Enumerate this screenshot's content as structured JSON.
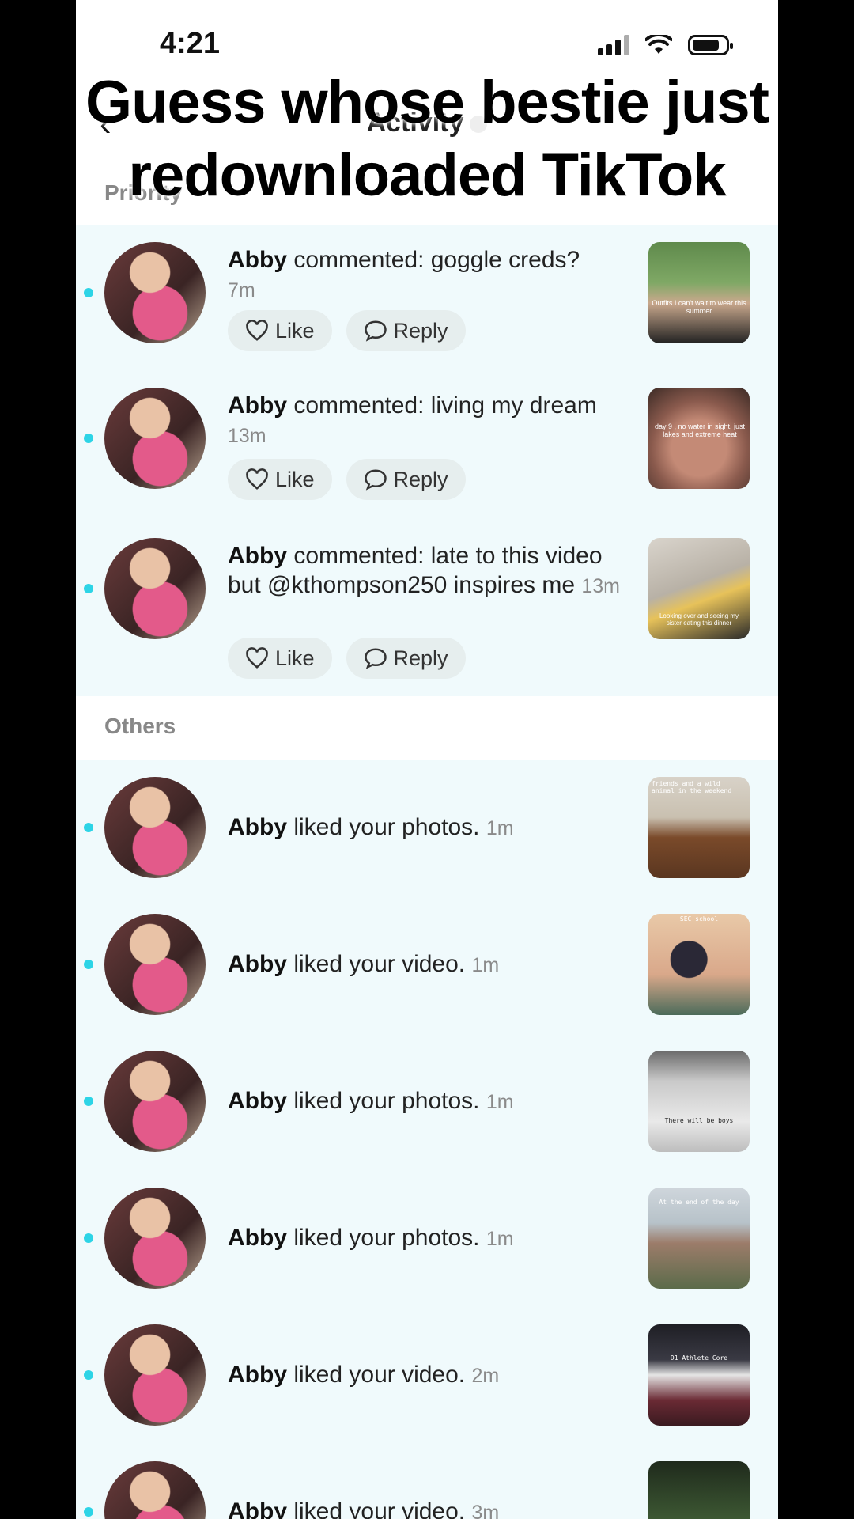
{
  "status_bar": {
    "time": "4:21"
  },
  "header": {
    "title": "Activity"
  },
  "overlay_caption": {
    "line1": "Guess whose bestie just",
    "line2": "redownloaded TikTok"
  },
  "sections": {
    "priority_label": "Priority",
    "others_label": "Others"
  },
  "actions": {
    "like": "Like",
    "reply": "Reply"
  },
  "priority_items": [
    {
      "user": "Abby",
      "text": "commented: goggle creds?",
      "time": "7m",
      "thumb_caption": "Outfits I can't wait to wear this summer"
    },
    {
      "user": "Abby",
      "text": "commented: living my dream",
      "time": "13m",
      "thumb_caption": "day 9 , no water in sight, just lakes and extreme heat"
    },
    {
      "user": "Abby",
      "text": "commented: late to this video but @kthompson250 inspires me",
      "time": "13m",
      "thumb_caption": "Looking over and seeing my sister eating this dinner"
    }
  ],
  "other_items": [
    {
      "user": "Abby",
      "text": "liked your photos.",
      "time": "1m",
      "thumb_caption": "friends and a wild animal in the weekend"
    },
    {
      "user": "Abby",
      "text": "liked your video.",
      "time": "1m",
      "thumb_caption": "SEC school"
    },
    {
      "user": "Abby",
      "text": "liked your photos.",
      "time": "1m",
      "thumb_caption": "There will be boys"
    },
    {
      "user": "Abby",
      "text": "liked your photos.",
      "time": "1m",
      "thumb_caption": "At the end of the day"
    },
    {
      "user": "Abby",
      "text": "liked your video.",
      "time": "2m",
      "thumb_caption": "D1 Athlete Core"
    },
    {
      "user": "Abby",
      "text": "liked your video.",
      "time": "3m",
      "thumb_caption": ""
    }
  ],
  "colors": {
    "unread_dot": "#2dd4e6",
    "section_bg": "#f0fafc",
    "pill_bg": "#e6eeee"
  },
  "icons": [
    "back-chevron-icon",
    "heart-icon",
    "speech-bubble-icon",
    "signal-icon",
    "wifi-icon",
    "battery-icon"
  ]
}
